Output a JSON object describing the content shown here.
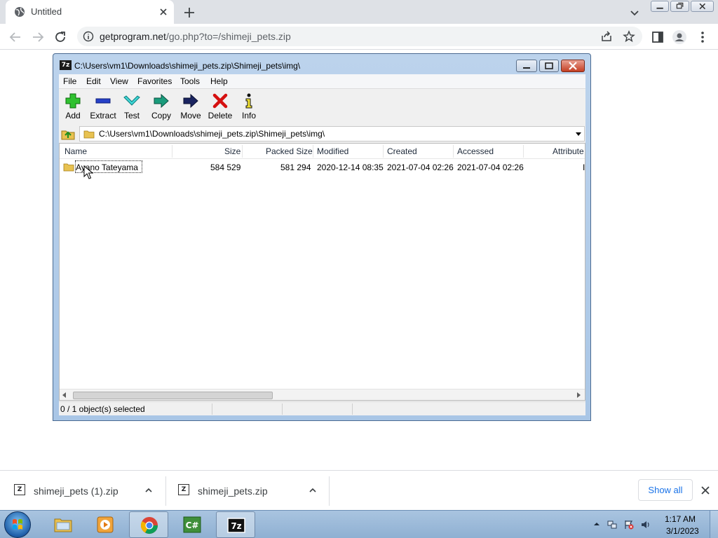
{
  "browser": {
    "tab_title": "Untitled",
    "url_host": "getprogram.net",
    "url_path": "/go.php?to=/shimeji_pets.zip"
  },
  "sevenzip": {
    "window_title": "C:\\Users\\vm1\\Downloads\\shimeji_pets.zip\\Shimeji_pets\\img\\",
    "app_icon_text": "7z",
    "menu": [
      "File",
      "Edit",
      "View",
      "Favorites",
      "Tools",
      "Help"
    ],
    "toolbar": [
      "Add",
      "Extract",
      "Test",
      "Copy",
      "Move",
      "Delete",
      "Info"
    ],
    "address": "C:\\Users\\vm1\\Downloads\\shimeji_pets.zip\\Shimeji_pets\\img\\",
    "columns": [
      "Name",
      "Size",
      "Packed Size",
      "Modified",
      "Created",
      "Accessed",
      "Attribute"
    ],
    "rows": [
      {
        "name": "Ayano Tateyama",
        "size": "584 529",
        "packed_size": "581 294",
        "modified": "2020-12-14 08:35",
        "created": "2021-07-04 02:26",
        "accessed": "2021-07-04 02:26",
        "attribute": "I"
      }
    ],
    "status": "0 / 1 object(s) selected"
  },
  "downloads": {
    "items": [
      {
        "name": "shimeji_pets (1).zip",
        "icon_text": "Z"
      },
      {
        "name": "shimeji_pets.zip",
        "icon_text": "Z"
      }
    ],
    "show_all": "Show all"
  },
  "taskbar": {
    "apps": [
      "explorer",
      "media-player",
      "chrome",
      "csharp",
      "7zip"
    ],
    "csharp_label": "C#",
    "sevenzip_label": "7z",
    "time": "1:17 AM",
    "date": "3/1/2023"
  },
  "colors": {
    "link_blue": "#1a73e8",
    "chrome_frame": "#dee1e6",
    "taskbar": "#a9c4e0"
  }
}
